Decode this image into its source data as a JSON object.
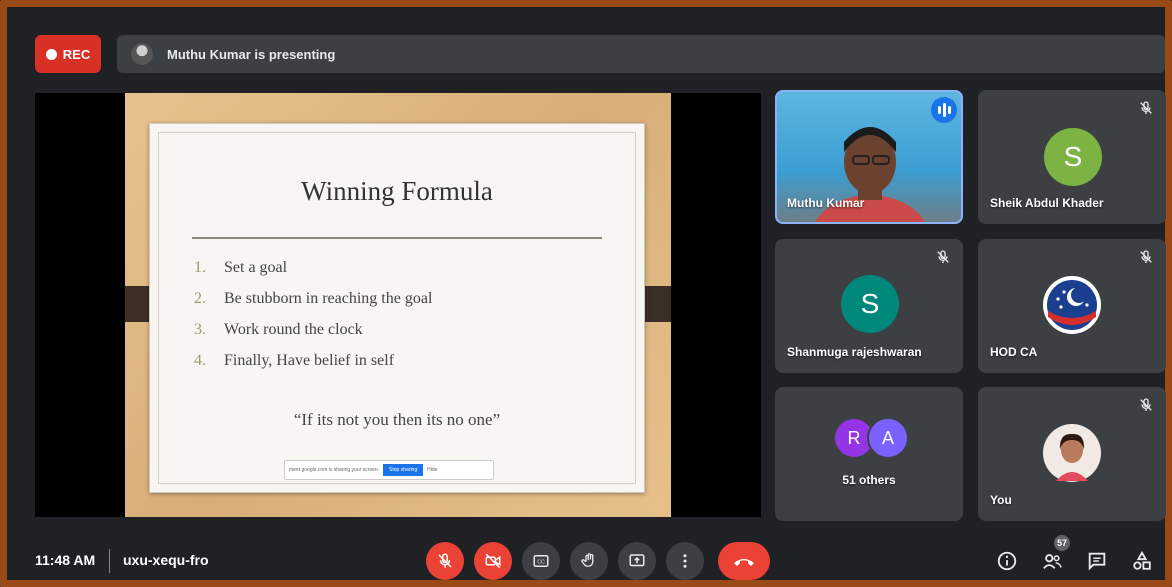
{
  "recording": {
    "label": "REC"
  },
  "presenting_banner": {
    "text": "Muthu Kumar is presenting"
  },
  "slide": {
    "title": "Winning Formula",
    "points": [
      {
        "num": "1.",
        "text": "Set a goal"
      },
      {
        "num": "2.",
        "text": "Be stubborn in reaching the goal"
      },
      {
        "num": "3.",
        "text": "Work round the clock"
      },
      {
        "num": "4.",
        "text": "Finally, Have belief  in self"
      }
    ],
    "quote": "“If its not you then its no one”",
    "share_notice": "meet.google.com is sharing your screen.",
    "share_stop_label": "Stop sharing",
    "share_hide_label": "Hide"
  },
  "participants": [
    {
      "name": "Muthu Kumar",
      "type": "video",
      "speaking": true
    },
    {
      "name": "Sheik Abdul Khader",
      "type": "letter",
      "letter": "S",
      "color": "#7cb342",
      "muted": true
    },
    {
      "name": "Shanmuga rajeshwaran",
      "type": "letter",
      "letter": "S",
      "color": "#00897b",
      "muted": true
    },
    {
      "name": "HOD CA",
      "type": "logo",
      "muted": true
    },
    {
      "name": "51 others",
      "type": "group",
      "letters": [
        "R",
        "A"
      ],
      "colors": [
        "#9334e6",
        "#7b61ff"
      ]
    },
    {
      "name": "You",
      "type": "photo",
      "muted": true
    }
  ],
  "bottom_bar": {
    "time": "11:48 AM",
    "meeting_code": "uxu-xequ-fro",
    "people_count": "57",
    "controls": [
      "mic-off-icon",
      "camera-off-icon",
      "captions-icon",
      "raise-hand-icon",
      "present-icon",
      "more-options-icon",
      "leave-call-icon"
    ],
    "right_icons": [
      "info-icon",
      "people-icon",
      "chat-icon",
      "activities-icon"
    ]
  }
}
